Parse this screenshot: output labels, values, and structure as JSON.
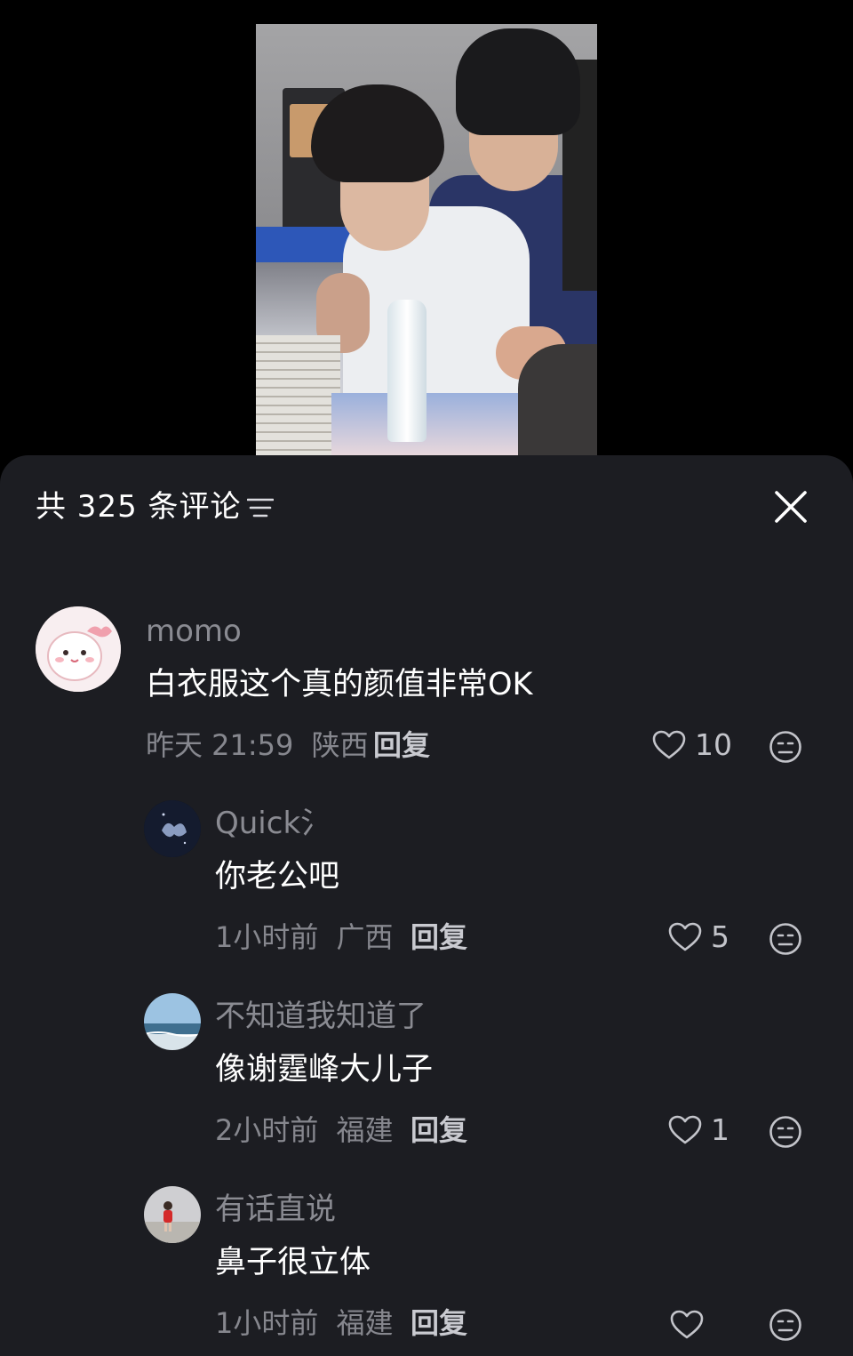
{
  "header": {
    "title": "共 325 条评论"
  },
  "comments": [
    {
      "username": "momo",
      "text": "白衣服这个真的颜值非常OK",
      "time": "昨天 21:59",
      "location": "陕西",
      "reply_label": "回复",
      "likes": "10"
    },
    {
      "username": "Quick氵",
      "text": "你老公吧",
      "time": "1小时前",
      "location": "广西",
      "reply_label": "回复",
      "likes": "5"
    },
    {
      "username": "不知道我知道了",
      "text": "像谢霆峰大儿子",
      "time": "2小时前",
      "location": "福建",
      "reply_label": "回复",
      "likes": "1"
    },
    {
      "username": "有话直说",
      "text": "鼻子很立体",
      "time": "1小时前",
      "location": "福建",
      "reply_label": "回复",
      "likes": ""
    }
  ]
}
